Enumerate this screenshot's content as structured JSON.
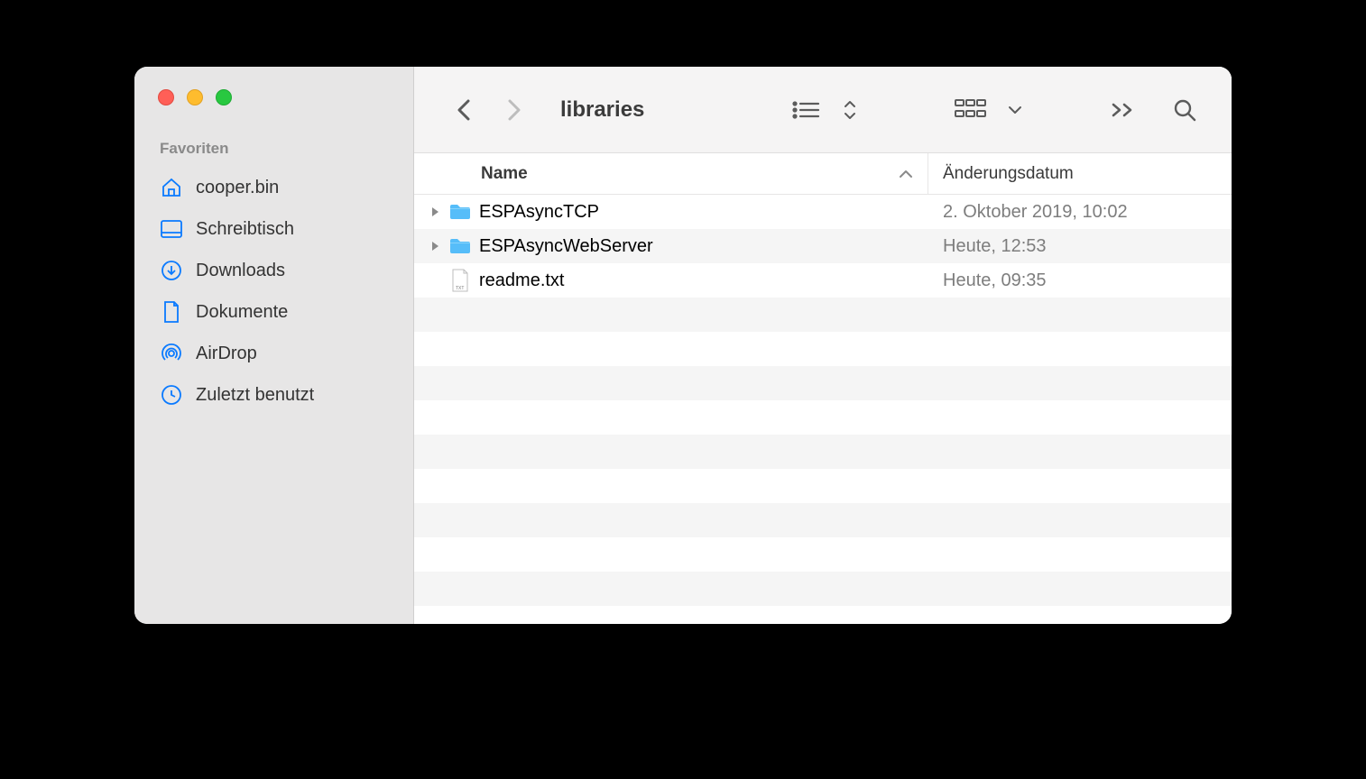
{
  "sidebar": {
    "section": "Favoriten",
    "items": [
      {
        "icon": "home",
        "label": "cooper.bin"
      },
      {
        "icon": "desktop",
        "label": "Schreibtisch"
      },
      {
        "icon": "download",
        "label": "Downloads"
      },
      {
        "icon": "document",
        "label": "Dokumente"
      },
      {
        "icon": "airdrop",
        "label": "AirDrop"
      },
      {
        "icon": "clock",
        "label": "Zuletzt benutzt"
      }
    ]
  },
  "toolbar": {
    "title": "libraries"
  },
  "columns": {
    "name": "Name",
    "date": "Änderungsdatum"
  },
  "rows": [
    {
      "type": "folder",
      "name": "ESPAsyncTCP",
      "date": "2. Oktober 2019, 10:02",
      "expandable": true
    },
    {
      "type": "folder",
      "name": "ESPAsyncWebServer",
      "date": "Heute, 12:53",
      "expandable": true
    },
    {
      "type": "txt",
      "name": "readme.txt",
      "date": "Heute, 09:35",
      "expandable": false
    }
  ]
}
